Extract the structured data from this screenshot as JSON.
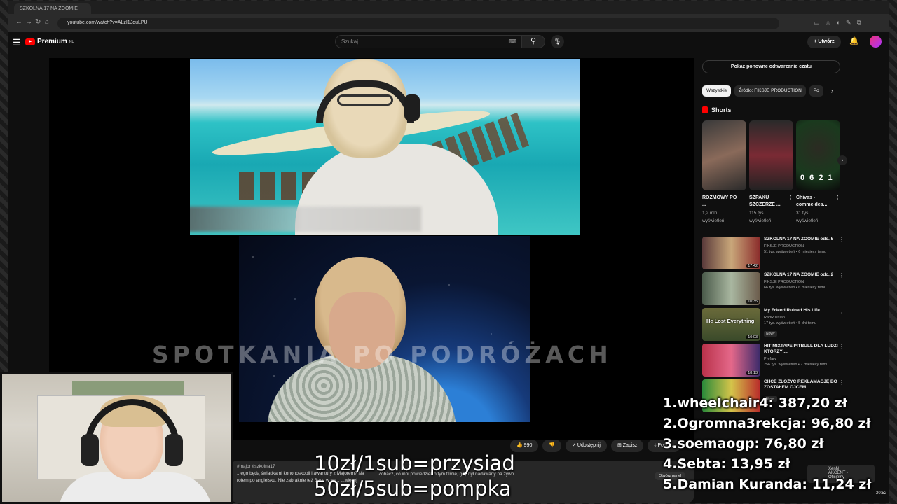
{
  "browser": {
    "tab_title": "SZKOLNA 17 NA ZOOMIE",
    "url": "youtube.com/watch?v=ALzI1JduLPU"
  },
  "youtube": {
    "logo_text": "Premium",
    "logo_region": "NL",
    "search_placeholder": "Szukaj",
    "create_label": "Utwórz"
  },
  "video": {
    "watermark": "SPOTKANIA PO PODRÓŻACH",
    "likes": "990",
    "share_label": "Udostępnij",
    "save_label": "Zapisz",
    "download_label": "Pobierz",
    "description_tags": "#major #szkolna17",
    "description_text_1": "...ego będą świadkami kononoskopii i awantury z Majorem? Na",
    "description_text_2": "rofem po angielsku. Nie zabraknie też Barki w wy... ...więcej",
    "chat_line": "Zobacz, co inni powiedzieli o tym filmie, gdy był nadawany na żywo.",
    "chat_button": "Otwórz panel"
  },
  "sidebar": {
    "replay_chat": "Pokaż ponowne odtwarzanie czatu",
    "chips": [
      "Wszystkie",
      "Źródło: FIKSJE PRODUCTION",
      "Po"
    ],
    "shorts_title": "Shorts",
    "shorts": [
      {
        "title": "ROZMOWY PO ...",
        "views": "1,2 mln",
        "views_label": "wyświetleń"
      },
      {
        "title": "SZPAKU SZCZERZE ...",
        "views": "115 tys.",
        "views_label": "wyświetleń"
      },
      {
        "title": "Chivas - comme des...",
        "views": "31 tys.",
        "views_label": "wyświetleń"
      }
    ],
    "short_timer": "0 6 2 1",
    "recommendations": [
      {
        "title": "SZKOLNA 17 NA ZOOMIE odc. 5",
        "channel": "FIKSJE PRODUCTION",
        "meta": "51 tys. wyświetleń • 6 miesięcy temu",
        "duration": "17:42",
        "badge": ""
      },
      {
        "title": "SZKOLNA 17 NA ZOOMIE odc. 2",
        "channel": "FIKSJE PRODUCTION",
        "meta": "66 tys. wyświetleń • 6 miesięcy temu",
        "duration": "10:35",
        "badge": ""
      },
      {
        "title": "My Friend Ruined His Life",
        "channel": "RadRussian",
        "meta": "17 tys. wyświetleń • 5 dni temu",
        "duration": "10:03",
        "badge": "Nowy",
        "thumb_text": "He Lost Everything"
      },
      {
        "title": "HIT MIXTAPE PITBULL DLA LUDZI KTÓRZY ...",
        "channel": "Prefary",
        "meta": "256 tys. wyświetleń • 7 miesięcy temu",
        "duration": "18:13",
        "badge": ""
      },
      {
        "title": "CHCE ZŁOŻYĆ REKLAMACJĘ BO ZOSTAŁEM OJCEM",
        "channel": "",
        "meta": "",
        "duration": "",
        "badge": "Nowy"
      }
    ]
  },
  "overlay": {
    "rule_1": "10zł/1sub=przysiad",
    "rule_2": "50zł/5sub=pompka",
    "donors": [
      "1.wheelchair4: 387,20 zł",
      "2.Ogromna3rekcja: 96,80 zł",
      "3.soemaogp: 76,80 zł",
      "4.Sebta: 13,95 zł",
      "5.Damian Kuranda: 11,24 zł"
    ],
    "mini_chat_name": "XenN",
    "mini_chat_channel": "AKCENT - Oficjalny",
    "clock": "20:52"
  }
}
